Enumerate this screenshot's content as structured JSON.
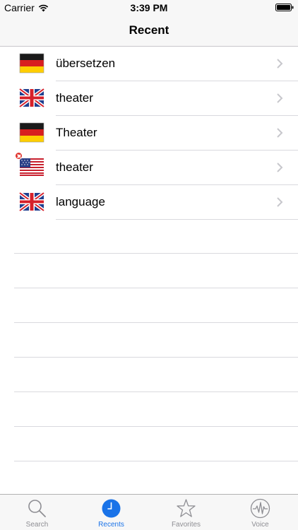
{
  "status_bar": {
    "carrier": "Carrier",
    "time": "3:39 PM"
  },
  "nav": {
    "title": "Recent"
  },
  "recents": [
    {
      "flag": "germany-flag",
      "word": "übersetzen",
      "badge": false
    },
    {
      "flag": "uk-flag",
      "word": "theater",
      "badge": false
    },
    {
      "flag": "germany-flag",
      "word": "Theater",
      "badge": false
    },
    {
      "flag": "usa-flag",
      "word": "theater",
      "badge": true
    },
    {
      "flag": "uk-flag",
      "word": "language",
      "badge": false
    }
  ],
  "tabs": [
    {
      "label": "Search",
      "icon": "search-icon",
      "active": false
    },
    {
      "label": "Recents",
      "icon": "clock-icon",
      "active": true
    },
    {
      "label": "Favorites",
      "icon": "star-icon",
      "active": false
    },
    {
      "label": "Voice",
      "icon": "voice-waveform-icon",
      "active": false
    }
  ],
  "colors": {
    "accent": "#1a73e8",
    "tab_inactive": "#8e8e93",
    "separator": "#d9d9de"
  }
}
